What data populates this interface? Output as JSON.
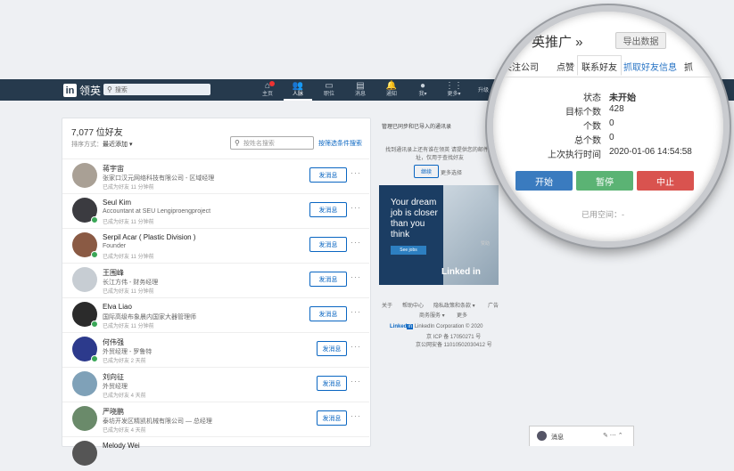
{
  "header": {
    "logo_text": "领英",
    "search_placeholder": "搜索",
    "nav": [
      {
        "label": "主页",
        "icon": "home-icon"
      },
      {
        "label": "人脉",
        "icon": "people-icon"
      },
      {
        "label": "职位",
        "icon": "briefcase-icon"
      },
      {
        "label": "消息",
        "icon": "messaging-icon"
      },
      {
        "label": "通知",
        "icon": "bell-icon"
      },
      {
        "label": "我▾",
        "icon": "me-avatar-icon"
      },
      {
        "label": "更多▾",
        "icon": "grid-icon"
      }
    ],
    "trailing": "升级"
  },
  "connections": {
    "count_label": "7,077 位好友",
    "sort_label": "排序方式：",
    "sort_value": "最近添加 ▾",
    "search_placeholder": "按姓名搜索",
    "advanced_search": "按筛选条件搜索",
    "message_button": "发消息",
    "items": [
      {
        "name": "蒋宇宙",
        "title": "张家口汉元网络科技有限公司 - 区域经理",
        "time": "已成为好友 11 分钟前",
        "avatar_color": "#a9a095",
        "online": false
      },
      {
        "name": "Seul Kim",
        "title": "Accountant at SEU Lengiproengproject",
        "time": "已成为好友 11 分钟前",
        "avatar_color": "#3b3b40",
        "online": true
      },
      {
        "name": "Serpil Acar ( Plastic Division )",
        "title": "Founder",
        "time": "已成为好友 11 分钟前",
        "avatar_color": "#8a5a44",
        "online": true
      },
      {
        "name": "王围峰",
        "title": "长江方伟 - 财务经理",
        "time": "已成为好友 11 分钟前",
        "avatar_color": "#c7cdd3",
        "online": false
      },
      {
        "name": "Elva Liao",
        "title": "国际高级布象晨内国家大器管理师",
        "time": "已成为好友 11 分钟前",
        "avatar_color": "#2b2b2b",
        "online": true
      },
      {
        "name": "何伟强",
        "title": "外贸经理 - 罗鲁特",
        "time": "已成为好友 2 天前",
        "avatar_color": "#2c3a8c",
        "online": true
      },
      {
        "name": "刘向征",
        "title": "外贸经理",
        "time": "已成为好友 4 天前",
        "avatar_color": "#7fa1b8",
        "online": false
      },
      {
        "name": "严晓鹏",
        "title": "泰坊开发区精凯机械有限公司 — 总经理",
        "time": "已成为好友 4 天前",
        "avatar_color": "#6a8a6a",
        "online": false
      },
      {
        "name": "Melody Wei",
        "title": "",
        "time": "",
        "avatar_color": "#555555",
        "online": false
      }
    ]
  },
  "sidebar": {
    "manage_label": "管理已同步和已导入的通讯录",
    "sub_text": "找到通讯录上还有谁在领英 请提供您的邮件地址，仅用于查找好友",
    "import_button": "继续",
    "more_options": "更多选择",
    "ad": {
      "text": "Your dream job is closer than you think",
      "button": "See jobs",
      "brand": "Linked in",
      "tag": "赞助"
    },
    "footer": {
      "links_row1": [
        "关于",
        "帮助中心",
        "隐私政策和条款 ▾",
        "广告"
      ],
      "links_row2": [
        "商务服务 ▾",
        "更多"
      ],
      "copyright": "LinkedIn Corporation © 2020",
      "icp": "京 ICP 备 17050271 号",
      "police": "京公网安备 11010502030412 号"
    }
  },
  "messaging_bar": {
    "label": "消息"
  },
  "magnifier": {
    "title": "英推广 »",
    "export_button": "导出数据",
    "tabs": [
      "关注公司",
      "点赞",
      "联系好友",
      "抓取好友信息",
      "抓"
    ],
    "active_tab_index": 2,
    "stats": [
      {
        "key": "状态",
        "value": "未开始"
      },
      {
        "key": "目标个数",
        "value": "428"
      },
      {
        "key": "个数",
        "value": "0"
      },
      {
        "key": "总个数",
        "value": "0"
      },
      {
        "key": "上次执行时间",
        "value": "2020-01-06 14:54:58"
      }
    ],
    "buttons": {
      "start": "开始",
      "pause": "暂停",
      "stop": "中止"
    },
    "used_space": "已用空间：-",
    "colors": {
      "start": "#3a7bbf",
      "pause": "#5bb374",
      "stop": "#d9534f"
    }
  }
}
